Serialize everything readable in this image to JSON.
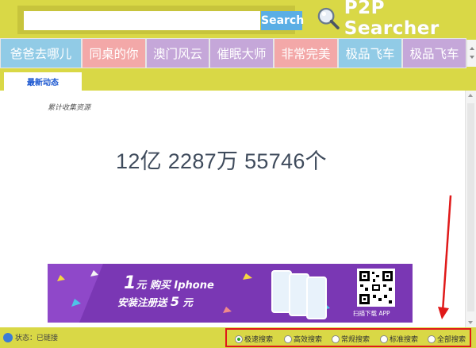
{
  "search": {
    "placeholder": "",
    "value": "",
    "button_label": "Search"
  },
  "app": {
    "title": "P2P Searcher"
  },
  "tabs": [
    {
      "label": "爸爸去哪儿",
      "color": "#91cbe6"
    },
    {
      "label": "同桌的你",
      "color": "#f3a8a8"
    },
    {
      "label": "澳门风云",
      "color": "#c5a7d9"
    },
    {
      "label": "催眠大师",
      "color": "#c5a7d9"
    },
    {
      "label": "非常完美",
      "color": "#f3a8a8"
    },
    {
      "label": "极品飞车",
      "color": "#91cbe6"
    },
    {
      "label": "极品飞车",
      "color": "#c5a7d9"
    }
  ],
  "subtab": {
    "label": "最新动态"
  },
  "content": {
    "caption": "累计收集资源",
    "count": "12亿 2287万 55746个"
  },
  "banner": {
    "price_num": "1",
    "price_unit": "元",
    "price_text": " 购买 Iphone",
    "line2_text": "安装注册送 ",
    "line2_num": "5",
    "line2_unit": " 元",
    "scan_text": "扫描下载 APP"
  },
  "status": {
    "text": "状态：已链接"
  },
  "search_modes": [
    {
      "label": "极速搜索",
      "selected": true
    },
    {
      "label": "高效搜索",
      "selected": false
    },
    {
      "label": "常规搜索",
      "selected": false
    },
    {
      "label": "标准搜索",
      "selected": false
    },
    {
      "label": "全部搜索",
      "selected": false
    }
  ],
  "colors": {
    "background": "#d9d846",
    "search_button": "#5aaee5",
    "banner": "#7a37b4",
    "highlight": "#e01919",
    "selected_radio": "#2aa52a"
  }
}
